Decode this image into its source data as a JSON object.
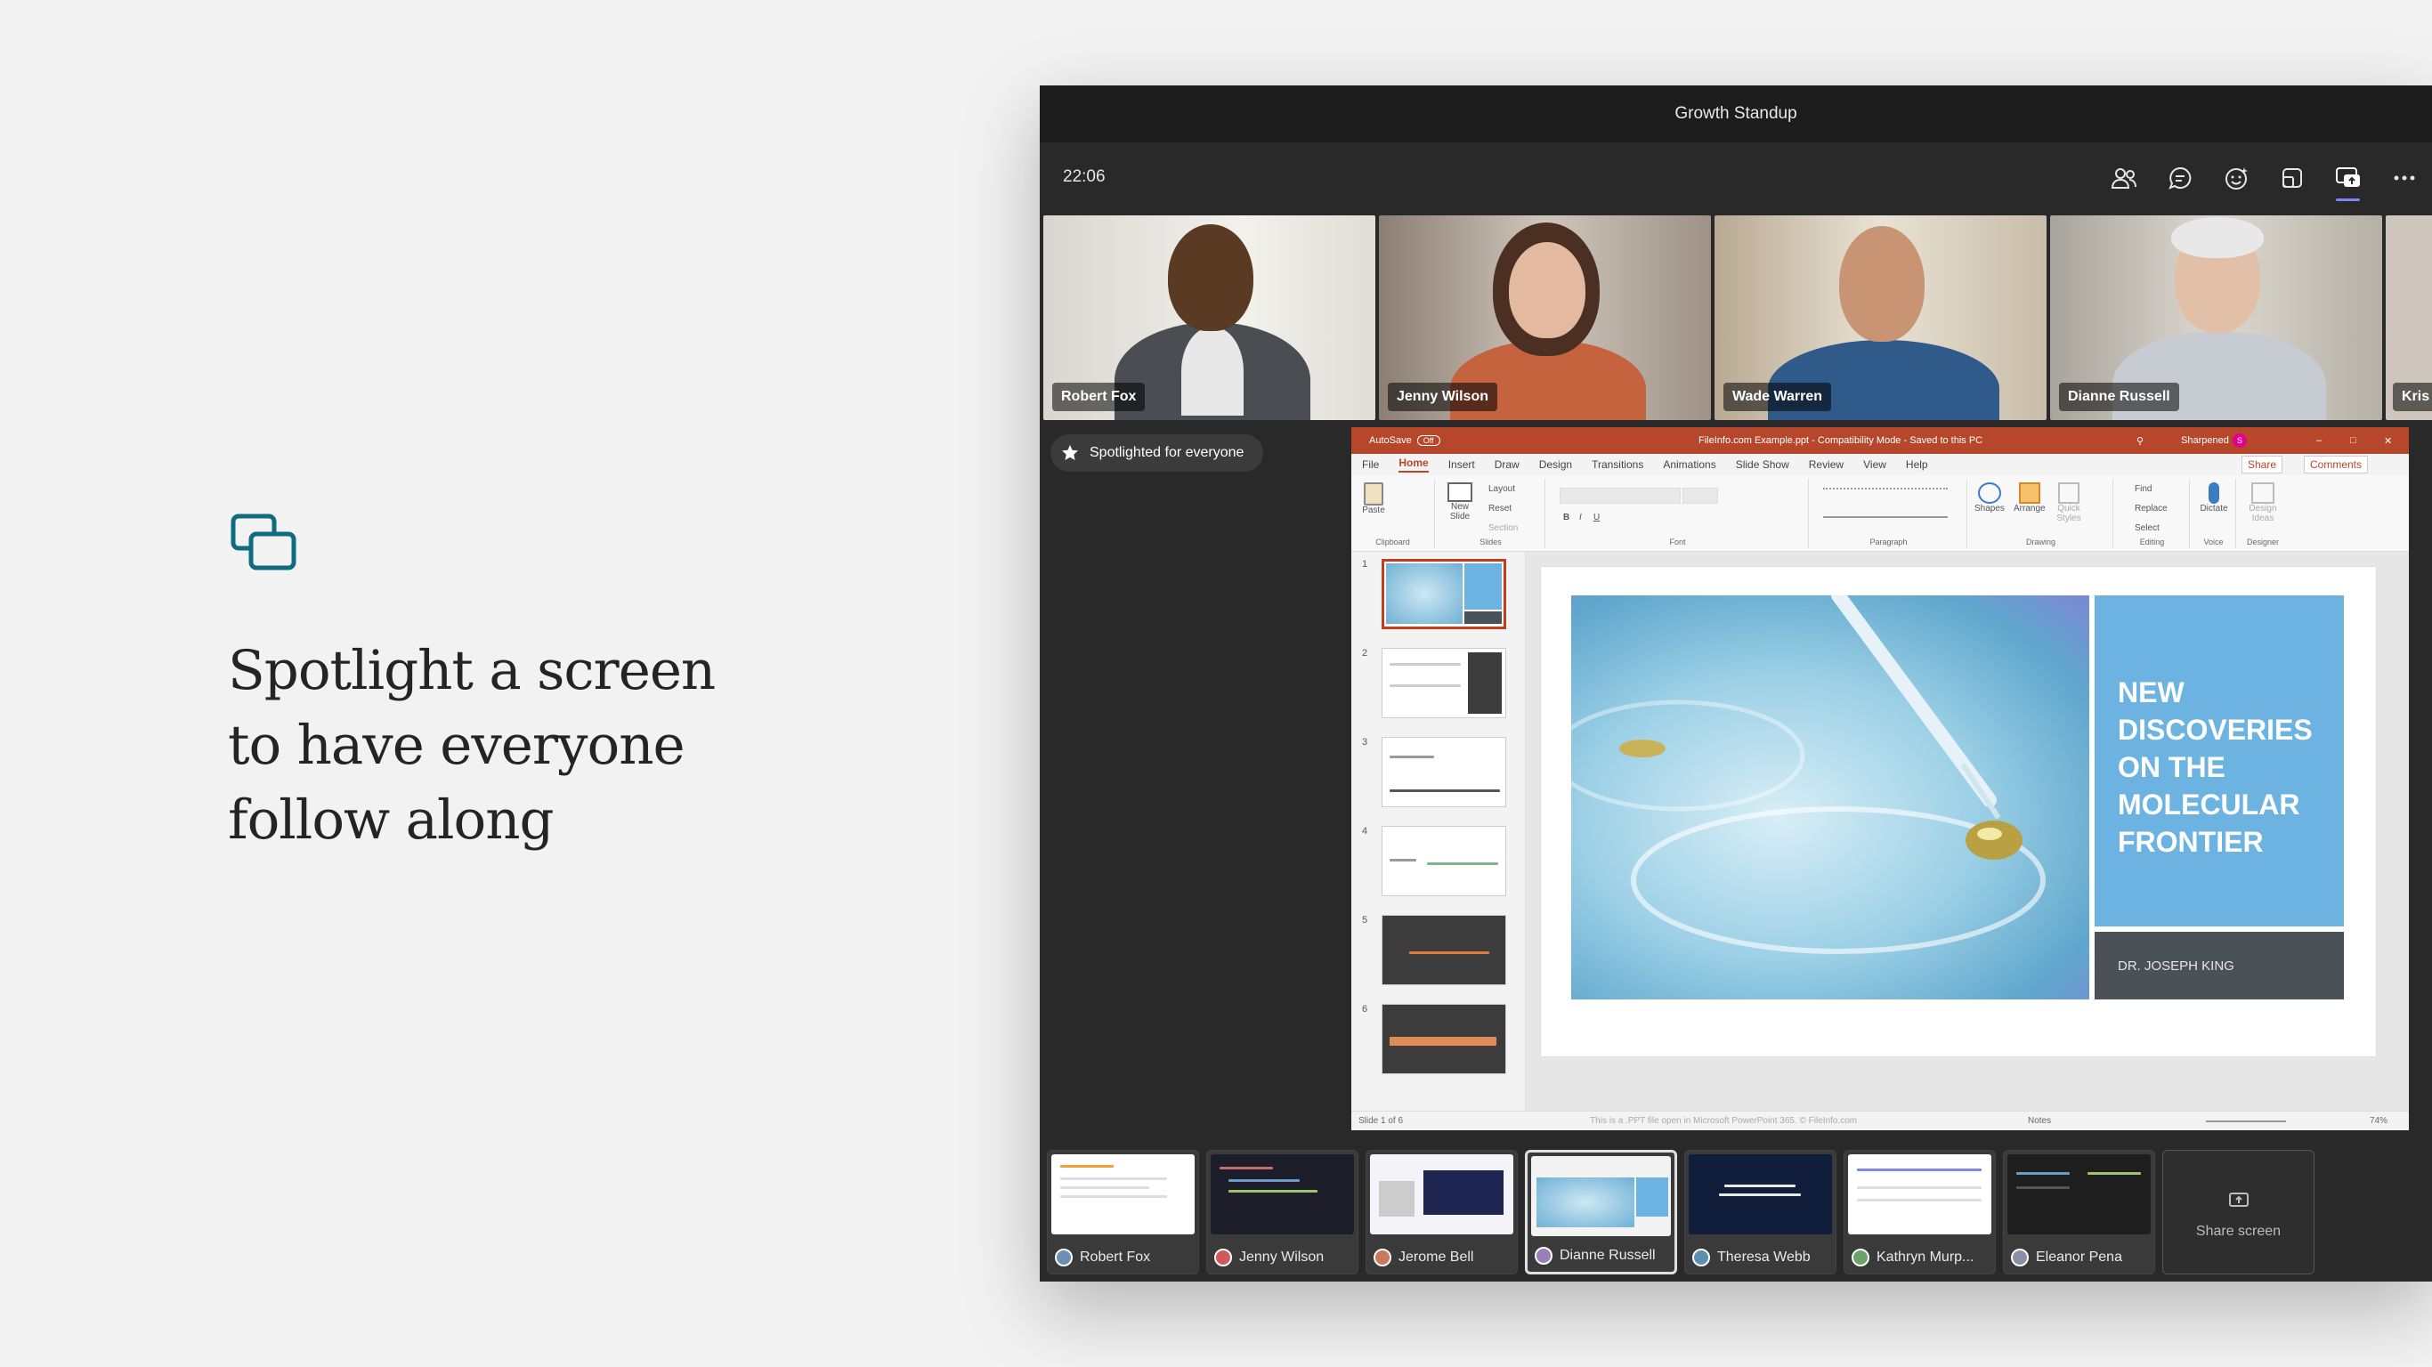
{
  "hero": {
    "icon": "screen-share-icon",
    "headline_lines": [
      "Spotlight a screen",
      "to have everyone",
      "follow along"
    ]
  },
  "window": {
    "title": "Growth Standup",
    "clock": "22:06",
    "toolbar_icons": [
      "people-icon",
      "chat-icon",
      "reactions-icon",
      "rooms-icon",
      "share-icon",
      "more-icon"
    ]
  },
  "participants": [
    {
      "name": "Robert Fox"
    },
    {
      "name": "Jenny Wilson"
    },
    {
      "name": "Wade Warren"
    },
    {
      "name": "Dianne Russell"
    },
    {
      "name": "Kris"
    }
  ],
  "spotlight_badge": "Spotlighted for everyone",
  "powerpoint": {
    "autosave": "AutoSave",
    "autosave_state": "Off",
    "doc_title": "FileInfo.com Example.ppt  -  Compatibility Mode  -  Saved to this PC",
    "user": "Sharpened",
    "user_initial": "S",
    "menu": [
      "File",
      "Home",
      "Insert",
      "Draw",
      "Design",
      "Transitions",
      "Animations",
      "Slide Show",
      "Review",
      "View",
      "Help"
    ],
    "share_label": "Share",
    "comments_label": "Comments",
    "ribbon_groups": [
      "Clipboard",
      "Slides",
      "Font",
      "Paragraph",
      "Drawing",
      "Editing",
      "Voice",
      "Designer"
    ],
    "ribbon_buttons": {
      "paste": "Paste",
      "new_slide": "New Slide",
      "layout": "Layout",
      "reset": "Reset",
      "section": "Section",
      "shapes": "Shapes",
      "arrange": "Arrange",
      "quick_styles": "Quick Styles",
      "find": "Find",
      "replace": "Replace",
      "select": "Select",
      "dictate": "Dictate",
      "design_ideas": "Design Ideas"
    },
    "slide_numbers": [
      "1",
      "2",
      "3",
      "4",
      "5",
      "6"
    ],
    "slide_title": "NEW DISCOVERIES ON THE MOLECULAR FRONTIER",
    "slide_author": "DR. JOSEPH KING",
    "status_left": "Slide 1 of 6",
    "status_center": "This is a .PPT file open in Microsoft PowerPoint 365. © FileInfo.com",
    "notes_label": "Notes",
    "zoom": "74%"
  },
  "shares": [
    {
      "name": "Robert Fox",
      "avatar_color": "#6b8fb5"
    },
    {
      "name": "Jenny Wilson",
      "avatar_color": "#d05a5a"
    },
    {
      "name": "Jerome Bell",
      "avatar_color": "#c97a5a"
    },
    {
      "name": "Dianne Russell",
      "avatar_color": "#9a7fb8"
    },
    {
      "name": "Theresa Webb",
      "avatar_color": "#5a8fb0"
    },
    {
      "name": "Kathryn Murp...",
      "avatar_color": "#6aa36a"
    },
    {
      "name": "Eleanor Pena",
      "avatar_color": "#8a8fa8"
    }
  ],
  "share_screen_label": "Share screen",
  "colors": {
    "accent": "#0f6b80",
    "ppt_red": "#b7472a",
    "slide_blue": "#6db3e2",
    "slide_gray": "#4a5157"
  }
}
